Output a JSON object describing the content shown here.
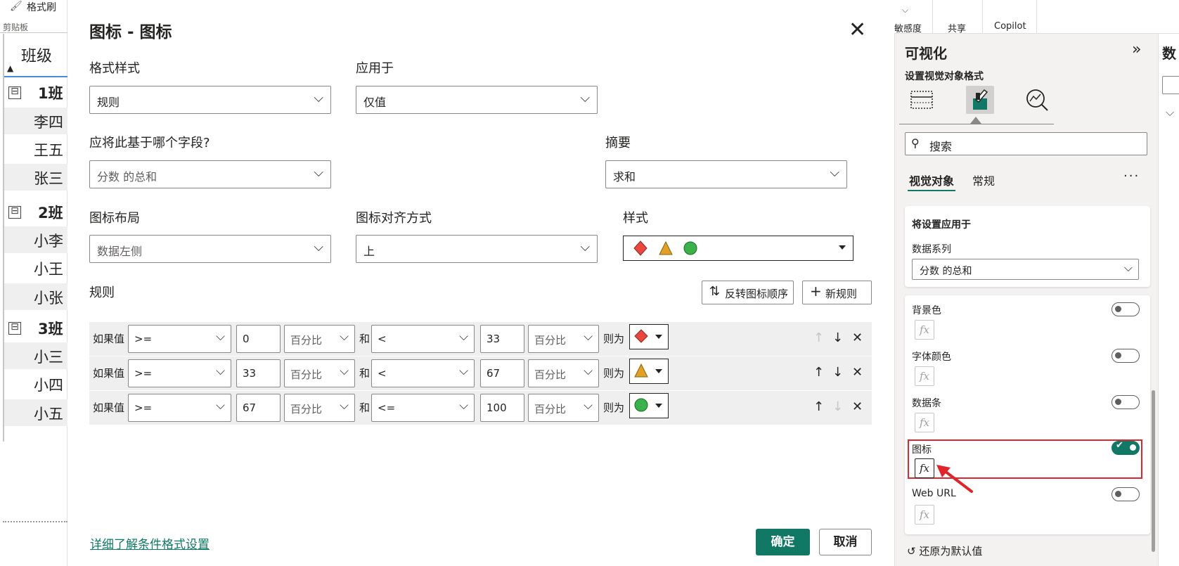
{
  "left": {
    "format_painter": "格式刷",
    "clipboard": "剪贴板",
    "matrix_header": "班级",
    "rows": [
      {
        "type": "group",
        "label": "1班",
        "exp": "⊟"
      },
      {
        "type": "item",
        "label": "李四"
      },
      {
        "type": "item",
        "label": "王五"
      },
      {
        "type": "item",
        "label": "张三"
      },
      {
        "type": "group",
        "label": "2班",
        "exp": "⊟"
      },
      {
        "type": "item",
        "label": "小李"
      },
      {
        "type": "item",
        "label": "小王"
      },
      {
        "type": "item",
        "label": "小张"
      },
      {
        "type": "group",
        "label": "3班",
        "exp": "⊟"
      },
      {
        "type": "item",
        "label": "小三"
      },
      {
        "type": "item",
        "label": "小四"
      },
      {
        "type": "item",
        "label": "小五"
      }
    ]
  },
  "dialog": {
    "title": "图标 - 图标",
    "format_style_label": "格式样式",
    "format_style_value": "规则",
    "apply_to_label": "应用于",
    "apply_to_value": "仅值",
    "based_on_label": "应将此基于哪个字段?",
    "based_on_value": "分数 的总和",
    "summary_label": "摘要",
    "summary_value": "求和",
    "icon_layout_label": "图标布局",
    "icon_layout_value": "数据左侧",
    "icon_align_label": "图标对齐方式",
    "icon_align_value": "上",
    "style_label": "样式",
    "rules_label": "规则",
    "reverse_button": "反转图标顺序",
    "new_rule_button": "新规则",
    "rules": [
      {
        "if_text": "如果值",
        "op1": ">=",
        "val1": "0",
        "unit1": "百分比",
        "and_text": "和",
        "op2": "<",
        "val2": "33",
        "unit2": "百分比",
        "then_text": "则为",
        "icon": "red-diamond",
        "up_disabled": true,
        "down_disabled": false
      },
      {
        "if_text": "如果值",
        "op1": ">=",
        "val1": "33",
        "unit1": "百分比",
        "and_text": "和",
        "op2": "<",
        "val2": "67",
        "unit2": "百分比",
        "then_text": "则为",
        "icon": "orange-triangle",
        "up_disabled": false,
        "down_disabled": false
      },
      {
        "if_text": "如果值",
        "op1": ">=",
        "val1": "67",
        "unit1": "百分比",
        "and_text": "和",
        "op2": "<=",
        "val2": "100",
        "unit2": "百分比",
        "then_text": "则为",
        "icon": "green-circle",
        "up_disabled": false,
        "down_disabled": true
      }
    ],
    "learn_more": "详细了解条件格式设置",
    "ok": "确定",
    "cancel": "取消",
    "colors": {
      "accent": "#117865",
      "red": "#e8483f",
      "orange": "#e2a126",
      "green": "#3bb14a"
    }
  },
  "ribbon": {
    "sensitivity": "敏感度",
    "share": "共享",
    "copilot": "Copilot"
  },
  "pane": {
    "title": "可视化",
    "subtitle": "设置视觉对象格式",
    "search_placeholder": "搜索",
    "tab_visual": "视觉对象",
    "tab_general": "常规",
    "apply_settings_to": "将设置应用于",
    "series_label": "数据系列",
    "series_value": "分数 的总和",
    "options": [
      {
        "label": "背景色",
        "on": false
      },
      {
        "label": "字体颜色",
        "on": false
      },
      {
        "label": "数据条",
        "on": false
      },
      {
        "label": "图标",
        "on": true
      },
      {
        "label": "Web URL",
        "on": false
      }
    ],
    "fx_label": "fx",
    "reset": "还原为默认值"
  },
  "far_right": {
    "title": "数"
  }
}
